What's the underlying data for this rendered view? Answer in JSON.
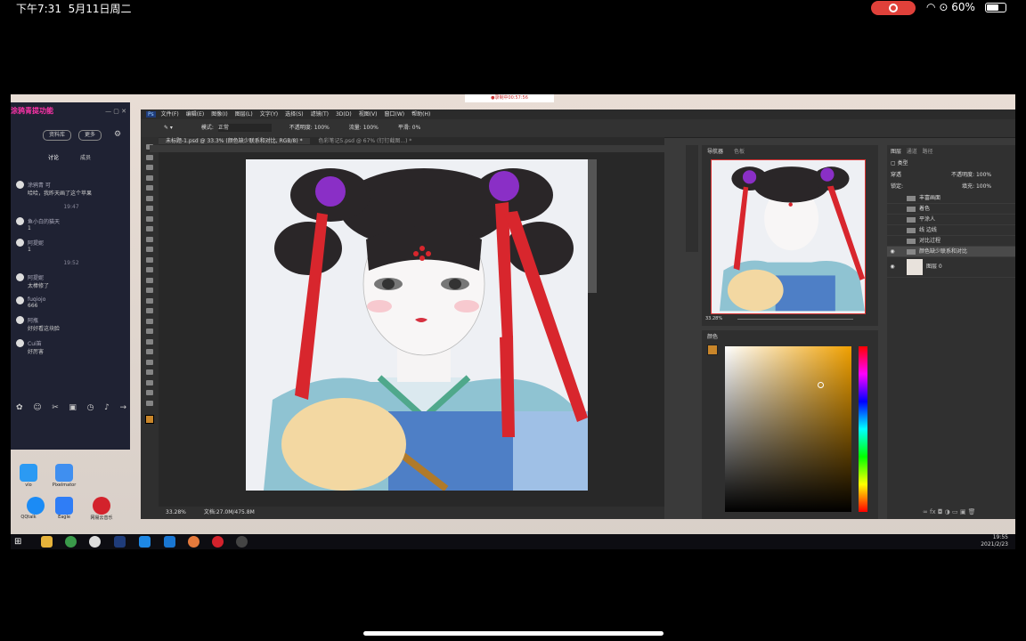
{
  "ipad": {
    "time": "下午7:31",
    "date": "5月11日周二",
    "battery": "60%",
    "battery_level": 0.6
  },
  "windows": {
    "recording_label": "●录制中00:57:56",
    "clock_time": "19:55",
    "clock_date": "2021/2/23"
  },
  "chat": {
    "title": "涂鸦青提功能",
    "buttons": [
      "资料库",
      "更多"
    ],
    "tabs": [
      "讨论",
      "成员"
    ],
    "messages": [
      {
        "time": "",
        "name": "涂鸦青 可",
        "text": "哈哈，我昨天画了这个苹果"
      },
      {
        "time": "19:47",
        "name": "鱼小白的猫天",
        "text": "1"
      },
      {
        "time": "",
        "name": "阿提妮",
        "text": "1"
      },
      {
        "time": "19:52",
        "name": "阿提妮",
        "text": "太棒修了"
      },
      {
        "time": "",
        "name": "fuqiojo",
        "text": "666"
      },
      {
        "time": "",
        "name": "阿瓶",
        "text": "好好看这块脸"
      },
      {
        "time": "",
        "name": "Cui笛",
        "text": "好厉害"
      }
    ]
  },
  "desktop_icons": [
    "vlo",
    "Pixelmator",
    "QQtalk",
    "Eagle",
    "网易云音乐"
  ],
  "photoshop": {
    "menu": [
      "文件(F)",
      "编辑(E)",
      "图像(I)",
      "图层(L)",
      "文字(Y)",
      "选择(S)",
      "滤镜(T)",
      "3D(D)",
      "视图(V)",
      "窗口(W)",
      "帮助(H)"
    ],
    "options": {
      "mode_label": "模式:",
      "mode": "正常",
      "opacity_label": "不透明度:",
      "opacity": "100%",
      "flow_label": "流量:",
      "flow": "100%",
      "smooth_label": "平滑:",
      "smooth": "0%"
    },
    "tabs": [
      "未标题-1.psd @ 33.3% (颜色缺少联系和对比, RGB/8) *",
      "色彩笔记5.psd @ 67% (钉钉截图...) *"
    ],
    "status_zoom": "33.28%",
    "status_doc": "文档:27.0M/475.8M",
    "navigator": {
      "tabs": [
        "导航器",
        "色板"
      ],
      "zoom": "33.28%"
    },
    "color_panel_tab": "颜色",
    "layers": {
      "tabs": [
        "图层",
        "通道",
        "路径"
      ],
      "kind": "类型",
      "blend": "穿透",
      "opacity_label": "不透明度:",
      "opacity": "100%",
      "lock_label": "锁定:",
      "fill_label": "填充:",
      "fill": "100%",
      "items": [
        "丰富画面",
        "着色",
        "平涂人",
        "线 边线",
        "对比过程",
        "颜色缺少联系和对比",
        "图层 0"
      ]
    }
  },
  "colors": {
    "ps_bg": "#3a3a3a",
    "accent_red": "#d8262d",
    "hair": "#2a2628",
    "purple": "#8a2fc6"
  }
}
